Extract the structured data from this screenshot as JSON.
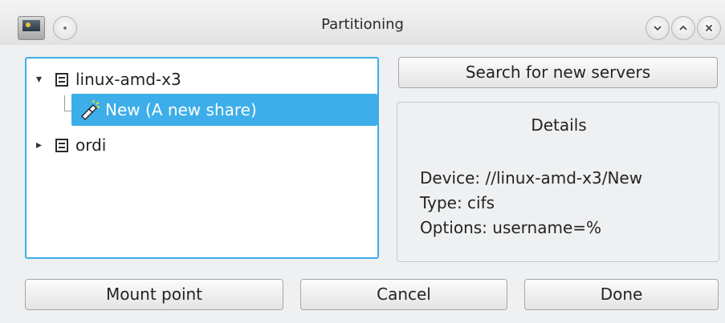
{
  "window": {
    "title": "Partitioning"
  },
  "titlebar": {
    "app_icon": "computer-icon",
    "sticky_icon": "sticky-icon",
    "buttons": [
      "minimize-icon",
      "maximize-icon",
      "close-icon"
    ]
  },
  "tree": {
    "items": [
      {
        "label": "linux-amd-x3",
        "expanded": true,
        "icon": "server-icon"
      },
      {
        "label": "New (A new share)",
        "selected": true,
        "icon": "share-icon"
      },
      {
        "label": "ordi",
        "expanded": false,
        "icon": "server-icon"
      }
    ]
  },
  "search_button": {
    "label": "Search for new servers"
  },
  "details": {
    "title": "Details",
    "lines": [
      "Device: //linux-amd-x3/New",
      "Type: cifs",
      "Options: username=%"
    ]
  },
  "footer": {
    "mount_point_label": "Mount point",
    "cancel_label": "Cancel",
    "done_label": "Done"
  },
  "colors": {
    "accent": "#3daee9",
    "window_bg": "#eff0f1"
  }
}
